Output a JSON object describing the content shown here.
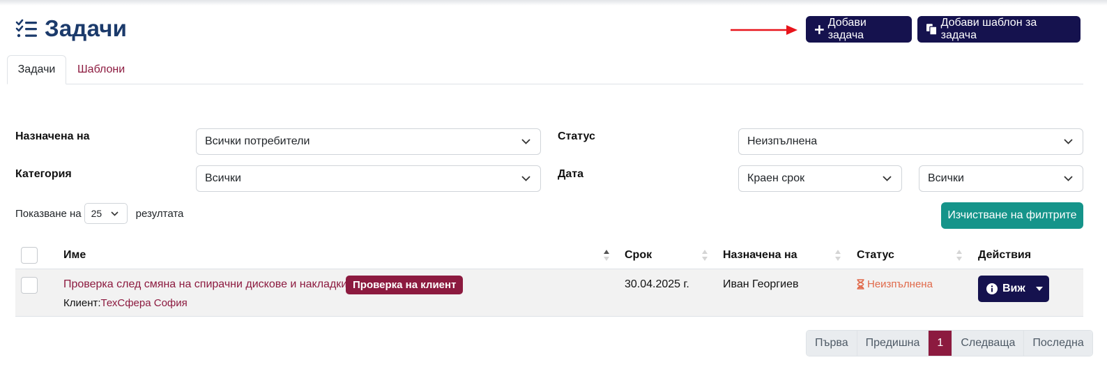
{
  "header": {
    "title": "Задачи",
    "add_task_label": "Добави задача",
    "add_template_label": "Добави шаблон за задача"
  },
  "tabs": [
    {
      "label": "Задачи",
      "active": true
    },
    {
      "label": "Шаблони",
      "active": false
    }
  ],
  "filters": {
    "assigned_label": "Назначена на",
    "assigned_value": "Всички потребители",
    "status_label": "Статус",
    "status_value": "Неизпълнена",
    "category_label": "Категория",
    "category_value": "Всички",
    "date_label": "Дата",
    "date_type_value": "Краен срок",
    "date_range_value": "Всички",
    "clear_label": "Изчистване на филтрите"
  },
  "paging": {
    "showing_prefix": "Показване на",
    "page_size": "25",
    "showing_suffix": "резултата",
    "first": "Първа",
    "prev": "Предишна",
    "current": "1",
    "next": "Следваща",
    "last": "Последна"
  },
  "table": {
    "columns": [
      "Име",
      "Срок",
      "Назначена на",
      "Статус",
      "Действия"
    ],
    "rows": [
      {
        "name": "Проверка след смяна на спирачни дискове и накладки",
        "badge": "Проверка на клиент",
        "client_label": "Клиент:",
        "client_name": "ТехСфера София",
        "due": "30.04.2025 г.",
        "assignee": "Иван Георгиев",
        "status": "Неизпълнена",
        "action_label": "Виж"
      }
    ]
  },
  "colors": {
    "primary_dark": "#15124e",
    "accent": "#8c1a3f",
    "teal": "#15948a",
    "status_pending": "#e0694a",
    "brand_title": "#1b3a6b"
  }
}
